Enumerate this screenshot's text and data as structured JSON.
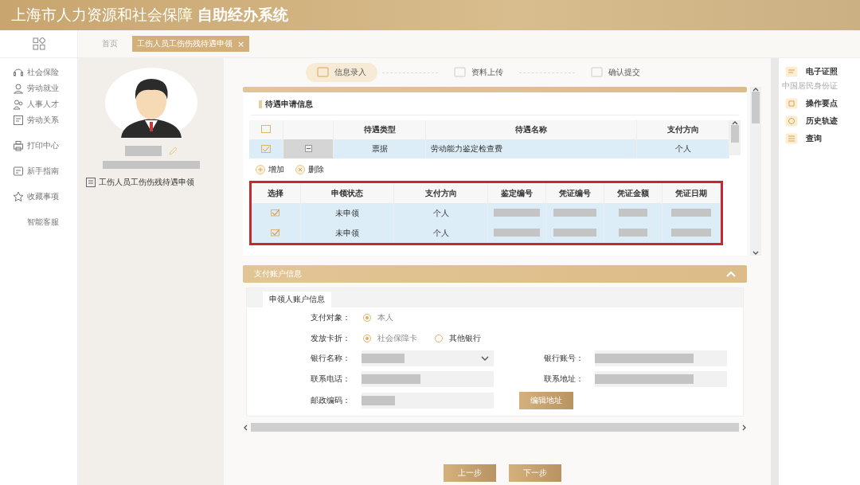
{
  "header": {
    "title": "上海市人力资源和社会保障 **自助经办系统**"
  },
  "tabs": [
    {
      "label": "首页",
      "selected": false
    },
    {
      "label": "工伤人员工伤伤残待遇申领",
      "selected": true,
      "close": "×"
    }
  ],
  "nav": [
    {
      "label": "社会保险"
    },
    {
      "label": "劳动就业"
    },
    {
      "label": "人事人才"
    },
    {
      "label": "劳动关系"
    },
    {
      "label": "打印中心"
    },
    {
      "label": "新手指南"
    },
    {
      "label": "收藏事项"
    },
    {
      "label": "智能客服"
    }
  ],
  "profile": {
    "item": "工伤人员工伤伤残待遇申领"
  },
  "steps": [
    {
      "label": "信息录入",
      "selected": true
    },
    {
      "label": "资料上传",
      "selected": false
    },
    {
      "label": "确认提交",
      "selected": false
    }
  ],
  "benefits": {
    "title": "待遇申请信息",
    "header_checked": false,
    "columns": [
      "待遇类型",
      "待遇名称",
      "支付方向"
    ],
    "rows": [
      {
        "checked": true,
        "type": "票据",
        "name": "劳动能力鉴定检查费",
        "direction": "个人"
      }
    ]
  },
  "toolbar": [
    {
      "label": "增加",
      "kind": "add"
    },
    {
      "label": "删除",
      "kind": "delete"
    }
  ],
  "claims": {
    "columns": [
      "选择",
      "申领状态",
      "支付方向",
      "鉴定编号",
      "凭证编号",
      "凭证金额",
      "凭证日期"
    ],
    "rows": [
      {
        "checked": true,
        "status": "未申领",
        "direction": "个人"
      },
      {
        "checked": true,
        "status": "未申领",
        "direction": "个人"
      }
    ]
  },
  "account": {
    "section_title": "支付账户信息",
    "tab": "申领人账户信息",
    "payee": {
      "label": "支付对象：",
      "options": [
        {
          "label": "本人",
          "selected": true
        }
      ]
    },
    "card": {
      "label": "发放卡折：",
      "options": [
        {
          "label": "社会保障卡",
          "selected": true
        },
        {
          "label": "其他银行",
          "selected": false
        }
      ]
    },
    "fields": [
      {
        "label": "银行名称：",
        "kind": "select"
      },
      {
        "label": "银行账号：",
        "kind": "text"
      },
      {
        "label": "联系电话：",
        "kind": "text"
      },
      {
        "label": "联系地址：",
        "kind": "text"
      },
      {
        "label": "邮政编码：",
        "kind": "text"
      }
    ],
    "edit_button": "编辑地址"
  },
  "right_panel": [
    {
      "label": "电子证照",
      "sub": "中国居民身份证"
    },
    {
      "label": "操作要点"
    },
    {
      "label": "历史轨迹"
    },
    {
      "label": "查询"
    }
  ],
  "buttons": [
    "上一步",
    "下一步"
  ]
}
